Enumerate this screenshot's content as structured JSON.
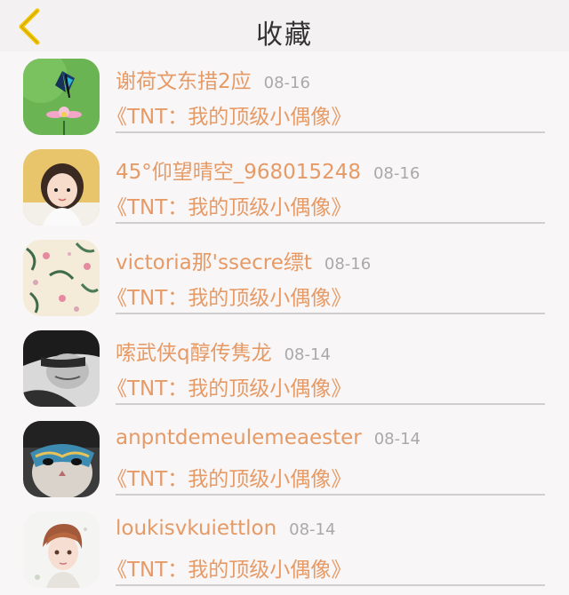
{
  "header": {
    "title": "收藏",
    "back_icon": "chevron-left-icon",
    "accent": "#f2c500"
  },
  "favorites": [
    {
      "name": "谢荷文东措2应",
      "date": "08-16",
      "work": "《TNT：我的顶级小偶像》",
      "avatar": "butterfly-flower-avatar"
    },
    {
      "name": "45°仰望晴空_968015248",
      "date": "08-16",
      "work": "《TNT：我的顶级小偶像》",
      "avatar": "girl-portrait-avatar"
    },
    {
      "name": "victoria那'ssecre缥t",
      "date": "08-16",
      "work": "《TNT：我的顶级小偶像》",
      "avatar": "floral-pattern-avatar"
    },
    {
      "name": "嗦武侠q醇传隽龙",
      "date": "08-14",
      "work": "《TNT：我的顶级小偶像》",
      "avatar": "bw-portrait-avatar"
    },
    {
      "name": "anpntdemeulemeaester",
      "date": "08-14",
      "work": "《TNT：我的顶级小偶像》",
      "avatar": "masked-cat-avatar"
    },
    {
      "name": "loukisvkuiettlon",
      "date": "08-14",
      "work": "《TNT：我的顶级小偶像》",
      "avatar": "anime-boy-avatar"
    }
  ],
  "colors": {
    "text_accent": "#e69a66",
    "date_gray": "#a9a9a9",
    "divider": "#cfcfcf"
  }
}
